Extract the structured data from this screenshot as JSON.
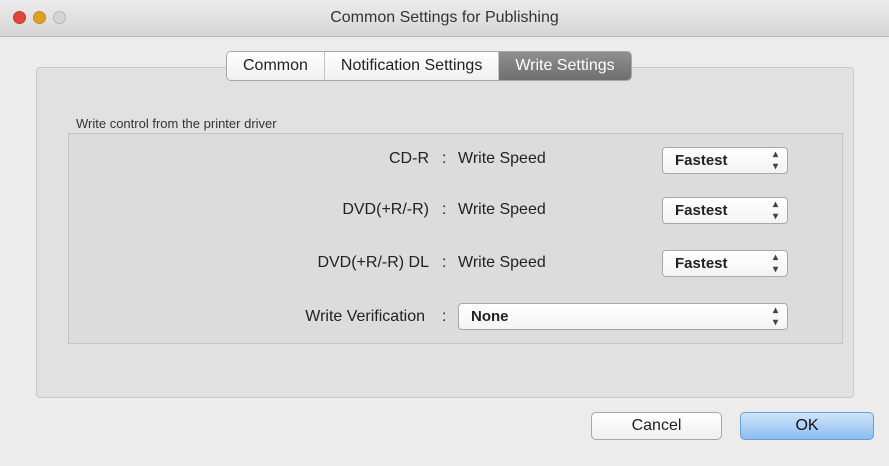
{
  "window": {
    "title": "Common Settings for Publishing"
  },
  "tabs": [
    {
      "label": "Common",
      "active": false
    },
    {
      "label": "Notification Settings",
      "active": false
    },
    {
      "label": "Write Settings",
      "active": true
    }
  ],
  "section": {
    "label": "Write control from the printer driver"
  },
  "rows": [
    {
      "media": "CD-R",
      "colon": ":",
      "setting": "Write Speed",
      "value": "Fastest"
    },
    {
      "media": "DVD(+R/-R)",
      "colon": ":",
      "setting": "Write Speed",
      "value": "Fastest"
    },
    {
      "media": "DVD(+R/-R) DL",
      "colon": ":",
      "setting": "Write Speed",
      "value": "Fastest"
    }
  ],
  "verification": {
    "label": "Write Verification",
    "colon": ":",
    "value": "None"
  },
  "buttons": {
    "cancel": "Cancel",
    "ok": "OK"
  },
  "icons": {
    "select_arrows": "up-down-chevron-icon",
    "close": "close-icon",
    "minimize": "minimize-icon",
    "zoom": "zoom-icon"
  },
  "colors": {
    "active_tab": "#7f7f7f",
    "ok_button": "#9cc7f2",
    "close": "#e0443e",
    "minimize": "#dea123"
  }
}
